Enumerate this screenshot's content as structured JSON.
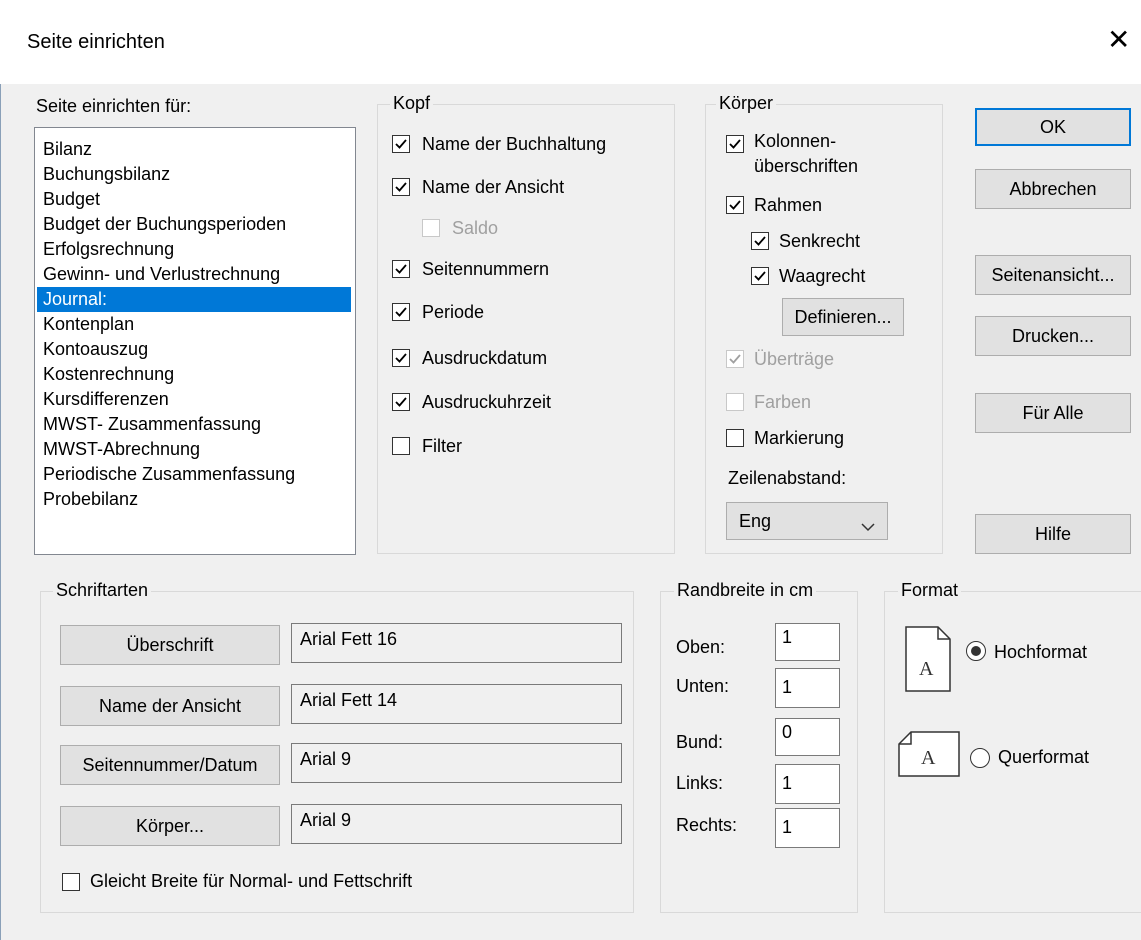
{
  "window": {
    "title": "Seite einrichten",
    "close_icon": "close-icon"
  },
  "setup_for": {
    "label": "Seite einrichten für:",
    "items": [
      "Bilanz",
      "Buchungsbilanz",
      "Budget",
      "Budget der Buchungsperioden",
      "Erfolgsrechnung",
      "Gewinn- und Verlustrechnung",
      "Journal:",
      "Kontenplan",
      "Kontoauszug",
      "Kostenrechnung",
      "Kursdifferenzen",
      "MWST- Zusammenfassung",
      "MWST-Abrechnung",
      "Periodische Zusammenfassung",
      "Probebilanz"
    ],
    "selected": "Journal:"
  },
  "kopf": {
    "title": "Kopf",
    "name_buchhaltung": {
      "label": "Name der Buchhaltung",
      "checked": true
    },
    "name_ansicht": {
      "label": "Name der Ansicht",
      "checked": true
    },
    "saldo": {
      "label": "Saldo",
      "checked": false,
      "disabled": true
    },
    "seitennummern": {
      "label": "Seitennummern",
      "checked": true
    },
    "periode": {
      "label": "Periode",
      "checked": true
    },
    "ausdruckdatum": {
      "label": "Ausdruckdatum",
      "checked": true
    },
    "ausdruckuhrzeit": {
      "label": "Ausdruckuhrzeit",
      "checked": true
    },
    "filter": {
      "label": "Filter",
      "checked": false
    }
  },
  "koerper": {
    "title": "Körper",
    "kolonnen": {
      "label_line1": "Kolonnen-",
      "label_line2": "überschriften",
      "checked": true
    },
    "rahmen": {
      "label": "Rahmen",
      "checked": true
    },
    "senkrecht": {
      "label": "Senkrecht",
      "checked": true
    },
    "waagrecht": {
      "label": "Waagrecht",
      "checked": true
    },
    "definieren": "Definieren...",
    "uebertraege": {
      "label": "Überträge",
      "checked": true,
      "disabled": true
    },
    "farben": {
      "label": "Farben",
      "checked": false,
      "disabled": true
    },
    "markierung": {
      "label": "Markierung",
      "checked": false
    },
    "zeilenabstand_label": "Zeilenabstand:",
    "zeilenabstand_value": "Eng"
  },
  "buttons": {
    "ok": "OK",
    "abbrechen": "Abbrechen",
    "seitenansicht": "Seitenansicht...",
    "drucken": "Drucken...",
    "fuer_alle": "Für Alle",
    "hilfe": "Hilfe"
  },
  "schriftarten": {
    "title": "Schriftarten",
    "rows": [
      {
        "button": "Überschrift",
        "value": "Arial Fett 16"
      },
      {
        "button": "Name der Ansicht",
        "value": "Arial Fett 14"
      },
      {
        "button": "Seitennummer/Datum",
        "value": "Arial 9"
      },
      {
        "button": "Körper...",
        "value": "Arial 9"
      }
    ],
    "gleiche_breite": {
      "label": "Gleicht Breite für Normal- und Fettschrift",
      "checked": false
    }
  },
  "randbreite": {
    "title": "Randbreite in cm",
    "oben": {
      "label": "Oben:",
      "value": "1"
    },
    "unten": {
      "label": "Unten:",
      "value": "1"
    },
    "bund": {
      "label": "Bund:",
      "value": "0"
    },
    "links": {
      "label": "Links:",
      "value": "1"
    },
    "rechts": {
      "label": "Rechts:",
      "value": "1"
    }
  },
  "format": {
    "title": "Format",
    "hochformat": {
      "label": "Hochformat",
      "selected": true
    },
    "querformat": {
      "label": "Querformat",
      "selected": false
    },
    "page_glyph": "A"
  }
}
